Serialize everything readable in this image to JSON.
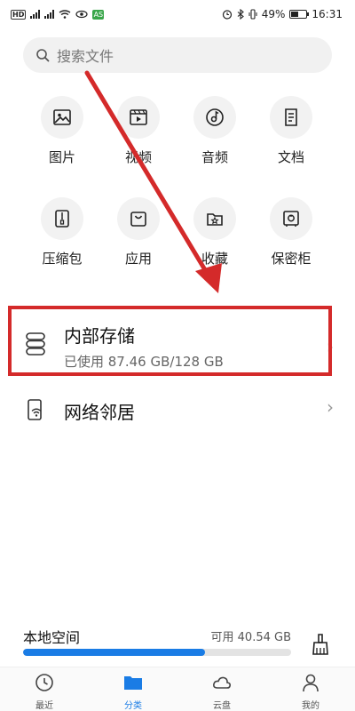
{
  "status_bar": {
    "hd": "HD",
    "battery_percent": "49%",
    "battery_level": 0.49,
    "time": "16:31",
    "app_badge": "AS"
  },
  "search": {
    "placeholder": "搜索文件"
  },
  "categories": [
    {
      "label": "图片",
      "icon": "image-icon"
    },
    {
      "label": "视频",
      "icon": "video-icon"
    },
    {
      "label": "音频",
      "icon": "audio-icon"
    },
    {
      "label": "文档",
      "icon": "document-icon"
    },
    {
      "label": "压缩包",
      "icon": "zip-icon"
    },
    {
      "label": "应用",
      "icon": "app-bag-icon"
    },
    {
      "label": "收藏",
      "icon": "favorites-icon"
    },
    {
      "label": "保密柜",
      "icon": "safe-icon"
    }
  ],
  "storage": {
    "internal_title": "内部存储",
    "internal_usage": "已使用 87.46 GB/128 GB",
    "network_title": "网络邻居"
  },
  "local_space": {
    "title": "本地空间",
    "available": "可用 40.54 GB",
    "used_fraction": 0.68
  },
  "nav": {
    "recent": "最近",
    "category": "分类",
    "cloud": "云盘",
    "mine": "我的"
  },
  "colors": {
    "accent": "#1a7ce5",
    "highlight": "#d42a2a"
  }
}
